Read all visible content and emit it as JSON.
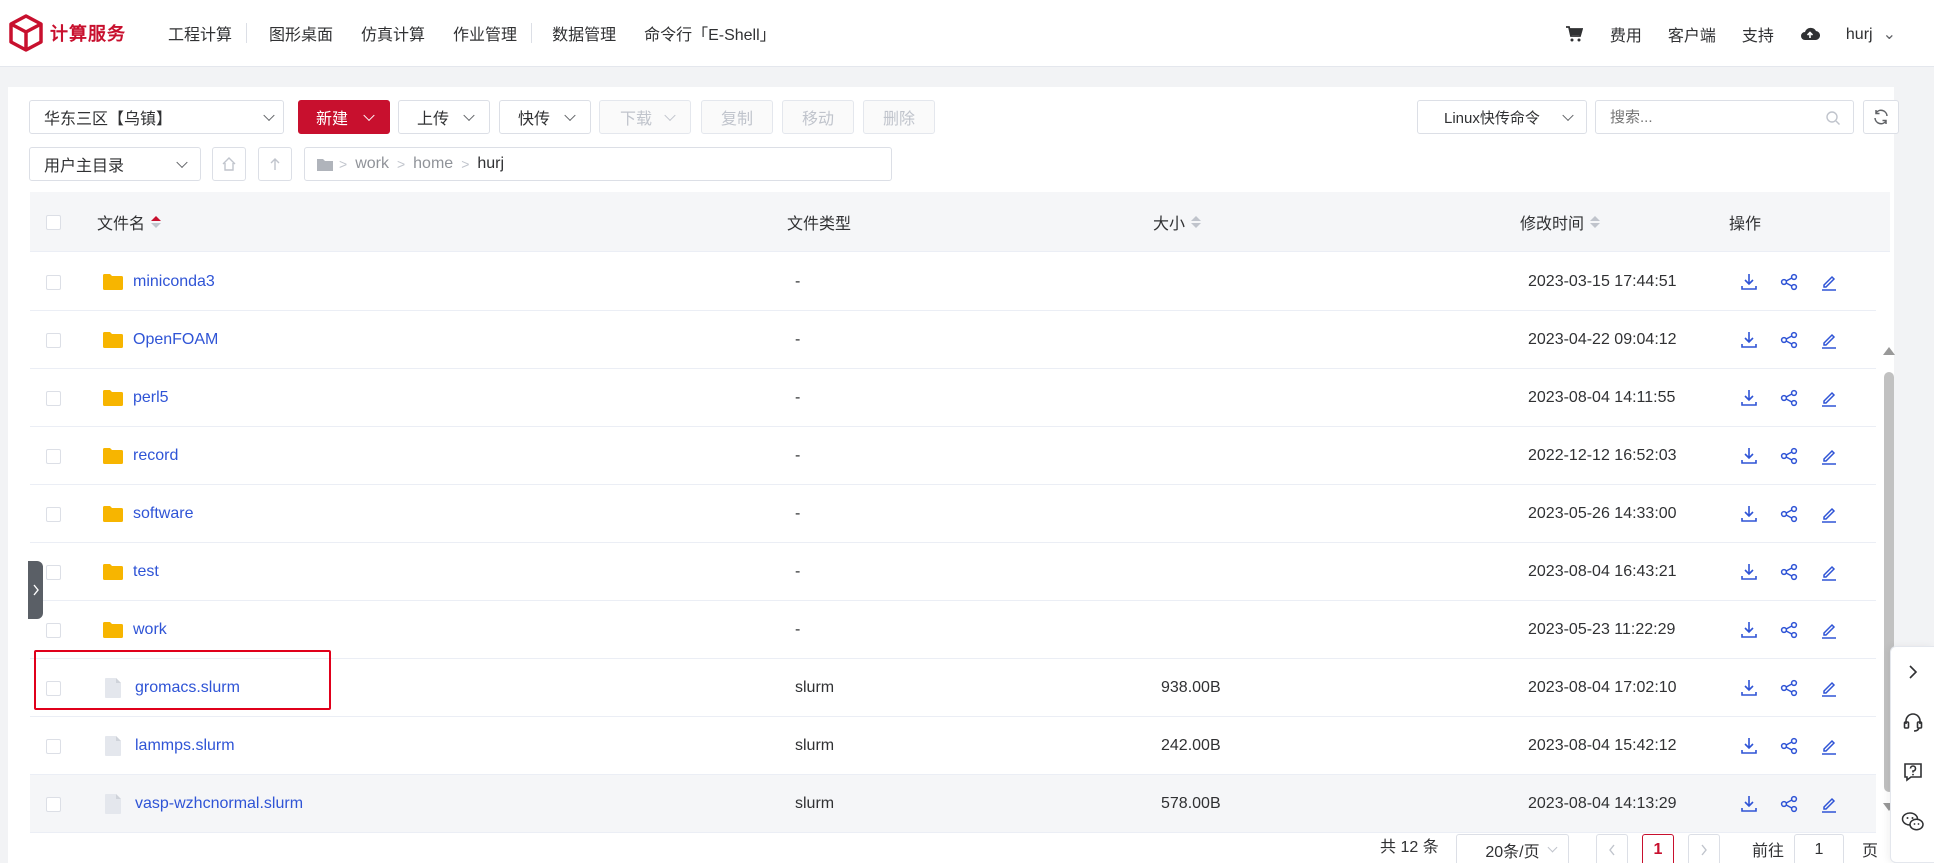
{
  "brand": {
    "name": "计算服务",
    "color": "#c8102e"
  },
  "nav": {
    "left": [
      "工程计算",
      "图形桌面",
      "仿真计算",
      "作业管理",
      "数据管理",
      "命令行「E-Shell」"
    ],
    "right": {
      "fees": "费用",
      "client": "客户端",
      "support": "支持",
      "user": "hurj"
    }
  },
  "toolbar": {
    "region": "华东三区【乌镇】",
    "new": "新建",
    "upload": "上传",
    "fast_upload": "快传",
    "download": "下载",
    "copy": "复制",
    "move": "移动",
    "delete": "删除",
    "linux_cmd": "Linux快传命令",
    "search_placeholder": "搜索...",
    "home_dir": "用户主目录"
  },
  "breadcrumb": [
    "work",
    "home",
    "hurj"
  ],
  "table": {
    "headers": {
      "name": "文件名",
      "type": "文件类型",
      "size": "大小",
      "mtime": "修改时间",
      "ops": "操作"
    },
    "rows": [
      {
        "name": "miniconda3",
        "kind": "folder",
        "type": "-",
        "size": "",
        "mtime": "2023-03-15 17:44:51"
      },
      {
        "name": "OpenFOAM",
        "kind": "folder",
        "type": "-",
        "size": "",
        "mtime": "2023-04-22 09:04:12"
      },
      {
        "name": "perl5",
        "kind": "folder",
        "type": "-",
        "size": "",
        "mtime": "2023-08-04 14:11:55"
      },
      {
        "name": "record",
        "kind": "folder",
        "type": "-",
        "size": "",
        "mtime": "2022-12-12 16:52:03"
      },
      {
        "name": "software",
        "kind": "folder",
        "type": "-",
        "size": "",
        "mtime": "2023-05-26 14:33:00"
      },
      {
        "name": "test",
        "kind": "folder",
        "type": "-",
        "size": "",
        "mtime": "2023-08-04 16:43:21"
      },
      {
        "name": "work",
        "kind": "folder",
        "type": "-",
        "size": "",
        "mtime": "2023-05-23 11:22:29"
      },
      {
        "name": "gromacs.slurm",
        "kind": "file",
        "type": "slurm",
        "size": "938.00B",
        "mtime": "2023-08-04 17:02:10"
      },
      {
        "name": "lammps.slurm",
        "kind": "file",
        "type": "slurm",
        "size": "242.00B",
        "mtime": "2023-08-04 15:42:12"
      },
      {
        "name": "vasp-wzhcnormal.slurm",
        "kind": "file",
        "type": "slurm",
        "size": "578.00B",
        "mtime": "2023-08-04 14:13:29"
      }
    ]
  },
  "pagination": {
    "total": "共 12 条",
    "page_size": "20条/页",
    "current": "1",
    "goto_prefix": "前往",
    "goto_value": "1",
    "goto_suffix": "页"
  },
  "colors": {
    "accent": "#c8102e",
    "link": "#2f54d6",
    "folder": "#f7b500"
  }
}
